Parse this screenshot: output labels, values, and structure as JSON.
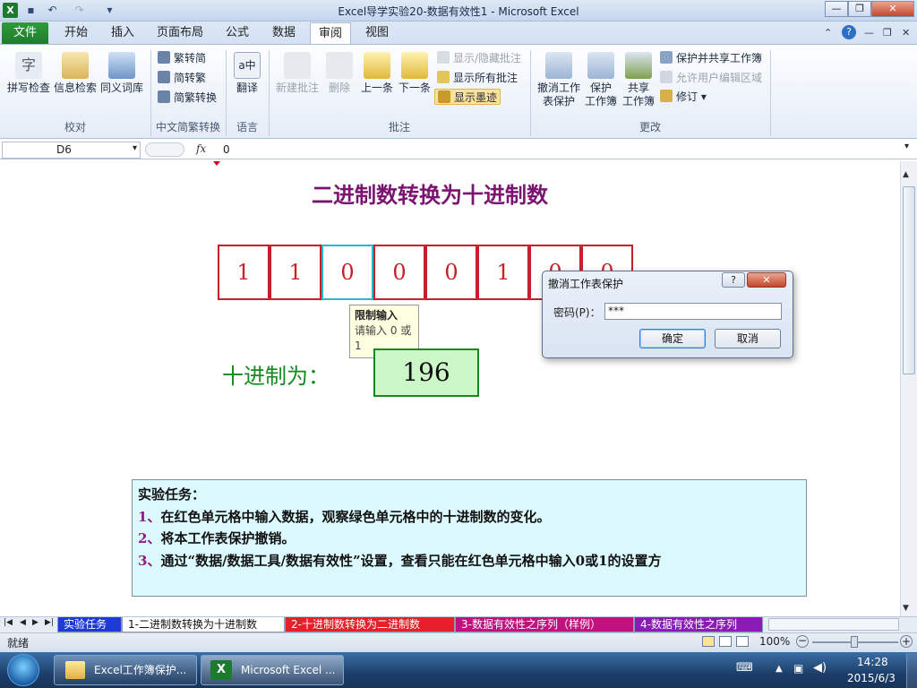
{
  "window": {
    "title": "Excel导学实验20-数据有效性1 - Microsoft Excel"
  },
  "ribbon_tabs": {
    "file": "文件",
    "items": [
      "开始",
      "插入",
      "页面布局",
      "公式",
      "数据",
      "审阅",
      "视图"
    ]
  },
  "ribbon": {
    "proofing": {
      "spell": "拼写检查",
      "research": "信息检索",
      "thesaurus": "同义词库",
      "group": "校对"
    },
    "chinese": {
      "to_simplified": "繁转简",
      "to_traditional": "简转繁",
      "convert": "简繁转换",
      "group": "中文简繁转换"
    },
    "language": {
      "translate": "翻译",
      "group": "语言"
    },
    "comments": {
      "new": "新建批注",
      "delete": "删除",
      "previous": "上一条",
      "next": "下一条",
      "show_hide": "显示/隐藏批注",
      "show_all": "显示所有批注",
      "show_ink": "显示墨迹",
      "group": "批注"
    },
    "changes": {
      "unprotect_sheet": [
        "撤消工作",
        "表保护"
      ],
      "protect_wb": [
        "保护",
        "工作簿"
      ],
      "share_wb": [
        "共享",
        "工作簿"
      ],
      "protect_share": "保护并共享工作簿",
      "allow_edit": "允许用户编辑区域",
      "track": "修订",
      "group": "更改"
    }
  },
  "formula_bar": {
    "cell_ref": "D6",
    "fx": "fx",
    "value": "0"
  },
  "sheet": {
    "heading": "二进制数转换为十进制数",
    "bits": [
      "1",
      "1",
      "0",
      "0",
      "0",
      "1",
      "0",
      "0"
    ],
    "tooltip": {
      "title": "限制输入",
      "body": "请输入 0 或 1"
    },
    "decimal_label": "十进制为：",
    "decimal_value": "196",
    "task": {
      "title": "实验任务：",
      "items": [
        {
          "num": "1、",
          "text": "在红色单元格中输入数据，观察绿色单元格中的十进制数的变化。"
        },
        {
          "num": "2、",
          "text": "将本工作表保护撤销。"
        },
        {
          "num": "3、",
          "text": "通过“数据/数据工具/数据有效性”设置，查看只能在红色单元格中输入0或1的设置方"
        }
      ]
    }
  },
  "dialog": {
    "title": "撤消工作表保护",
    "help": "?",
    "close": "✕",
    "password_label": "密码(P)：",
    "password_value": "***",
    "ok": "确定",
    "cancel": "取消"
  },
  "sheet_tabs": [
    "实验任务",
    "1-二进制数转换为十进制数",
    "2-十进制数转换为二进制数",
    "3-数据有效性之序列（样例）",
    "4-数据有效性之序列"
  ],
  "status": {
    "ready": "就绪",
    "zoom": "100%"
  },
  "taskbar": {
    "app1": "Excel工作簿保护...",
    "app2": "Microsoft Excel ...",
    "time": "14:28",
    "date": "2015/6/3"
  }
}
